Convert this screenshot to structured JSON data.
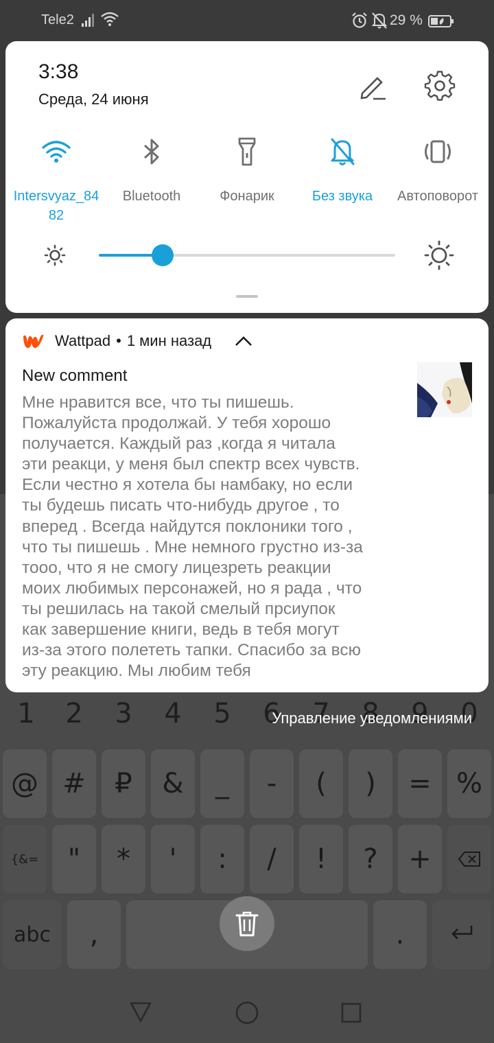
{
  "status_bar": {
    "carrier": "Tele2",
    "battery": "29 %",
    "icons": [
      "signal-icon",
      "wifi-icon",
      "alarm-icon",
      "mute-icon",
      "battery-icon"
    ]
  },
  "quick_settings": {
    "time": "3:38",
    "date": "Среда, 24 июня",
    "tiles": [
      {
        "label": "Intersvyaz_84\n82",
        "icon": "wifi-icon",
        "active": true
      },
      {
        "label": "Bluetooth",
        "icon": "bluetooth-icon",
        "active": false
      },
      {
        "label": "Фонарик",
        "icon": "flashlight-icon",
        "active": false
      },
      {
        "label": "Без звука",
        "icon": "mute-bell-icon",
        "active": true
      },
      {
        "label": "Автоповорот",
        "icon": "auto-rotate-icon",
        "active": false
      }
    ],
    "brightness_fraction": 0.215
  },
  "notification": {
    "app_name": "Wattpad",
    "separator": "•",
    "time_ago": "1 мин назад",
    "title": "New comment",
    "body": "Мне нравится все, что ты пишешь.\nПожалуйста продолжай. У тебя хорошо\nполучается. Каждый раз ,когда я читала\nэти реакци, у меня был спектр всех чувств.\nЕсли честно  я хотела бы намбаку, но если\nты будешь писать что-нибудь другое , то\nвперед . Всегда найдутся поклоники того ,\nчто ты пишешь . Мне немного грустно из-за\nтооо, что я не смогу лицезреть реакции\nмоих любимых персонажей, но я рада , что\nты решилась на такой смелый прсиупок\nкак завершение книги, ведь в тебя могут\nиз-за этого полететь тапки. Спасибо за всю\nэту реакцию. Мы любим тебя"
  },
  "manage_notifications": "Управление уведомлениями",
  "keyboard": {
    "numbers": [
      "1",
      "2",
      "3",
      "4",
      "5",
      "6",
      "7",
      "8",
      "9",
      "0"
    ],
    "row1": [
      "@",
      "#",
      "₽",
      "&",
      "_",
      "-",
      "(",
      ")",
      "=",
      "%"
    ],
    "row2": [
      "{&=",
      "\"",
      "*",
      "'",
      ":",
      "/",
      "!",
      "?",
      "+"
    ],
    "row3": [
      "abc",
      ",",
      "."
    ]
  },
  "colors": {
    "accent": "#1aa0d8",
    "wattpad": "#ff500a"
  }
}
